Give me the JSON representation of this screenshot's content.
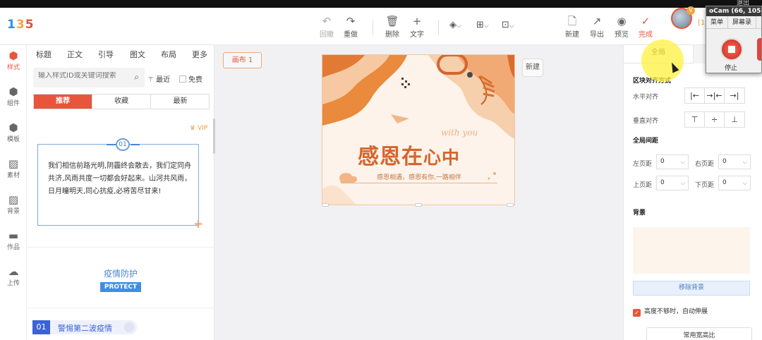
{
  "os_bar": {
    "exit_label": "退出"
  },
  "logo": {
    "p1": "1",
    "p2": "3",
    "p3": "5"
  },
  "toolbar": {
    "undo": "回撤",
    "redo": "重做",
    "delete": "删除",
    "text": "文字",
    "new": "新建",
    "export": "导出",
    "preview": "预览",
    "done": "完成",
    "user_tag": "[1"
  },
  "ocam": {
    "title": "oCam (66, 105,",
    "menu_1": "菜单",
    "menu_2": "屏幕录",
    "stop": "停止"
  },
  "rail": [
    {
      "label": "样式",
      "icon": "cube-icon"
    },
    {
      "label": "组件",
      "icon": "cube-icon"
    },
    {
      "label": "模板",
      "icon": "cube-icon"
    },
    {
      "label": "素材",
      "icon": "image-icon"
    },
    {
      "label": "背景",
      "icon": "image-icon"
    },
    {
      "label": "作品",
      "icon": "folder-icon"
    },
    {
      "label": "上传",
      "icon": "cloud-upload-icon"
    }
  ],
  "panel": {
    "categories": [
      "标题",
      "正文",
      "引导",
      "图文",
      "布局",
      "更多"
    ],
    "search_placeholder": "输入样式ID或关键词搜索",
    "recent": "最近",
    "free": "免费",
    "segments": [
      "推荐",
      "收藏",
      "最新"
    ],
    "vip": "VIP",
    "card1_number": "01",
    "card1_text": "我们相信前路光明,阴霾终会散去，我们定同舟共济,风雨共度一切都会好起来。山河共风雨， 日月瞳明天,同心抗疫,必将苦尽甘来!",
    "card2_title": "疫情防护",
    "card2_tag": "PROTECT",
    "card3_number": "01",
    "card3_text": "警惕第二波疫情"
  },
  "canvas": {
    "label": "画布 1",
    "new_button": "新建",
    "art_with": "with you",
    "art_title_big": "感恩在",
    "art_title_small": "心中",
    "art_subtitle": "感恩相遇，感恩有你,一路相伴"
  },
  "right_panel": {
    "tab_global": "全局",
    "tab_other": "",
    "block_align": "区块对齐方式",
    "h_align": "水平对齐",
    "v_align": "垂直对齐",
    "global_margin": "全局间距",
    "left_margin": "左页距",
    "right_margin": "右页距",
    "top_margin": "上页距",
    "bottom_margin": "下页距",
    "left_value": "0",
    "right_value": "0",
    "top_value": "0",
    "bottom_value": "0",
    "background": "背景",
    "remove_bg": "移除背景",
    "auto_stretch": "高度不够时，自动伸展",
    "ratio": "常用宽高比"
  },
  "colors": {
    "accent": "#e8553c",
    "blue": "#3d8fe4",
    "art_orange": "#d6652d"
  }
}
